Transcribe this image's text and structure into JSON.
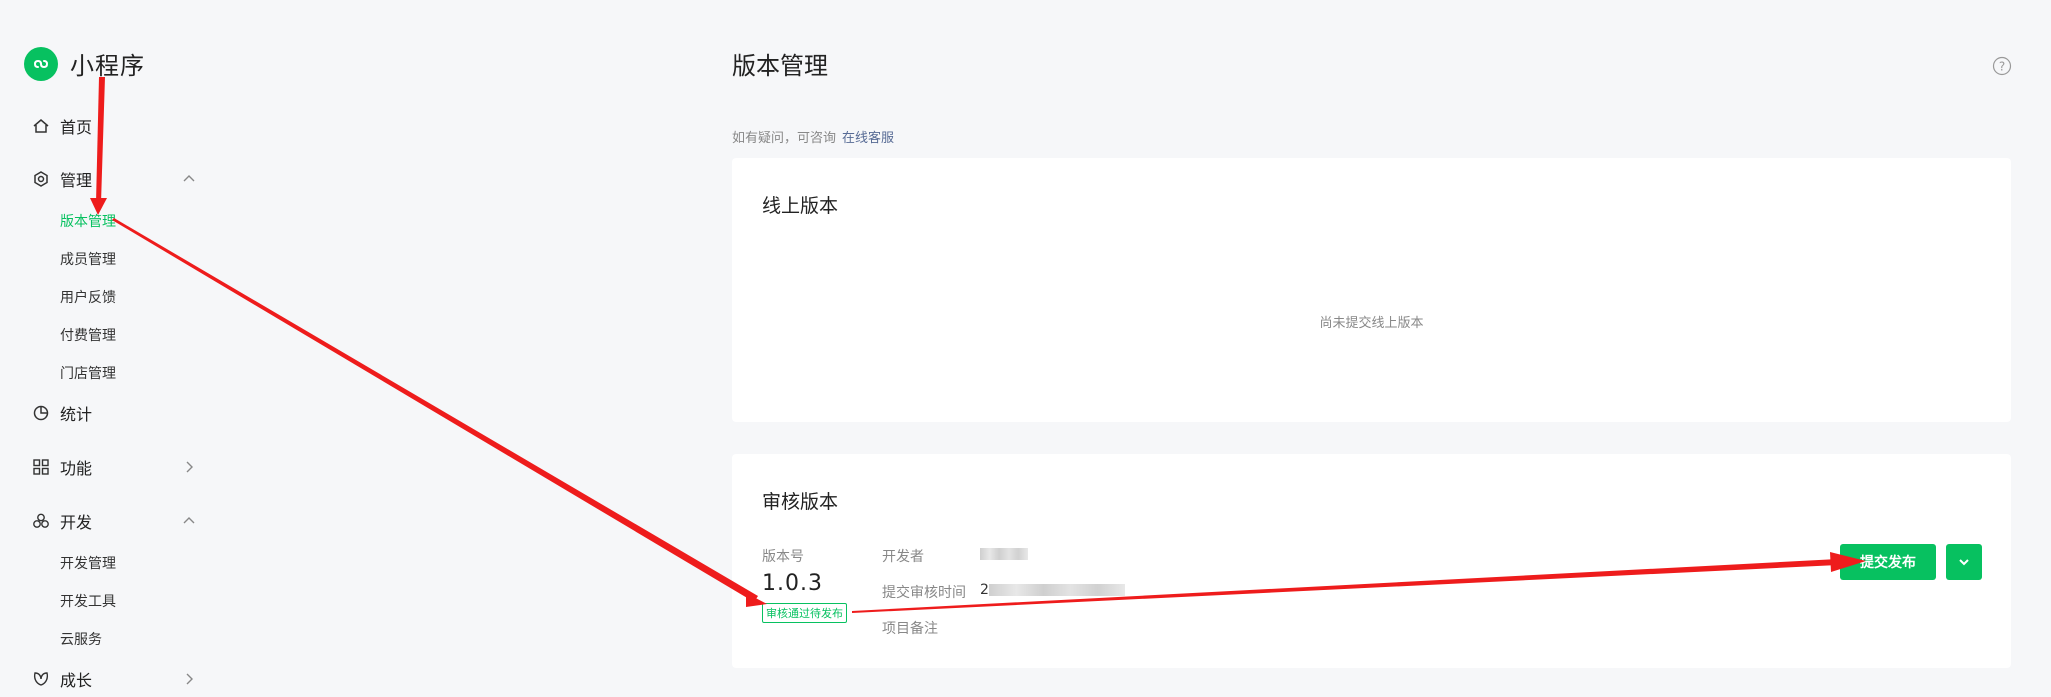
{
  "sidebar": {
    "brand": "小程序",
    "items": {
      "home": "首页",
      "manage": "管理",
      "stats": "统计",
      "features": "功能",
      "dev": "开发",
      "growth": "成长"
    },
    "manage_sub": [
      "版本管理",
      "成员管理",
      "用户反馈",
      "付费管理",
      "门店管理"
    ],
    "dev_sub": [
      "开发管理",
      "开发工具",
      "云服务"
    ]
  },
  "main": {
    "title": "版本管理",
    "hint_text": "如有疑问，可咨询",
    "hint_link": "在线客服",
    "online": {
      "title": "线上版本",
      "empty": "尚未提交线上版本"
    },
    "review": {
      "title": "审核版本",
      "version_label": "版本号",
      "version_value": "1.0.3",
      "status": "审核通过待发布",
      "developer_label": "开发者",
      "submit_time_label": "提交审核时间",
      "submit_time_prefix": "2",
      "note_label": "项目备注",
      "submit_button": "提交发布"
    }
  },
  "colors": {
    "accent": "#07c160",
    "link": "#576b95",
    "annotation": "#ee1c1c"
  }
}
